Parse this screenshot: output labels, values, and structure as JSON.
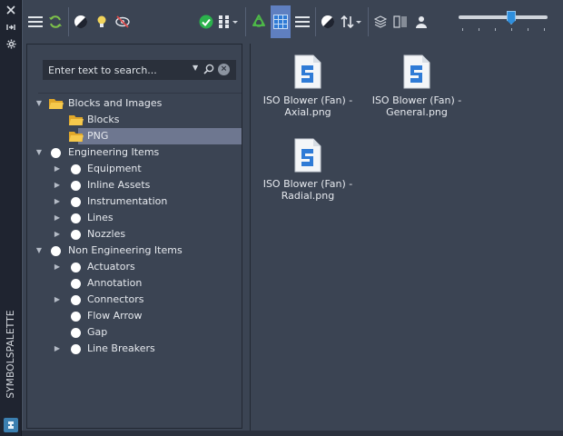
{
  "palette": {
    "title": "SYMBOLSPALETTE",
    "strip_icons": [
      "menu-icon",
      "pin-icon",
      "settings-icon",
      "app-logo-icon"
    ]
  },
  "toolbar": {
    "icons": [
      "hamburger-menu-icon",
      "refresh-icon",
      "contrast-icon",
      "lightbulb-icon",
      "visibility-toggle-icon",
      "checkmark-icon",
      "grid-options-icon",
      "recycle-icon",
      "grid-view-icon",
      "list-view-icon",
      "display-mode-icon",
      "sort-icon",
      "layers-icon",
      "text-abc-icon",
      "user-icon"
    ],
    "zoom_level": 0.6
  },
  "search": {
    "placeholder": "Enter text to search..."
  },
  "tree": [
    {
      "label": "Blocks and Images",
      "expanded": true,
      "icon": "folder-open-icon",
      "children": [
        {
          "label": "Blocks",
          "icon": "folder-open-icon"
        },
        {
          "label": "PNG",
          "icon": "folder-open-icon",
          "selected": true
        }
      ]
    },
    {
      "label": "Engineering Items",
      "expanded": true,
      "icon": "circle-icon",
      "children": [
        {
          "label": "Equipment",
          "expandable": true
        },
        {
          "label": "Inline Assets",
          "expandable": true
        },
        {
          "label": "Instrumentation",
          "expandable": true
        },
        {
          "label": "Lines",
          "expandable": true
        },
        {
          "label": "Nozzles",
          "expandable": true
        }
      ]
    },
    {
      "label": "Non Engineering Items",
      "expanded": true,
      "icon": "circle-icon",
      "children": [
        {
          "label": "Actuators",
          "expandable": true
        },
        {
          "label": "Annotation",
          "expandable": false
        },
        {
          "label": "Connectors",
          "expandable": true
        },
        {
          "label": "Flow Arrow",
          "expandable": false
        },
        {
          "label": "Gap",
          "expandable": false
        },
        {
          "label": "Line Breakers",
          "expandable": true
        }
      ]
    }
  ],
  "files": [
    {
      "line1": "ISO Blower (Fan) -",
      "line2": "Axial.png"
    },
    {
      "line1": "ISO Blower (Fan) -",
      "line2": "General.png"
    },
    {
      "line1": "ISO Blower (Fan) -",
      "line2": "Radial.png"
    }
  ],
  "colors": {
    "panel": "#3b4453",
    "strip": "#1f2430",
    "selection": "#6e7790",
    "accent_blue": "#2f8fdd",
    "check_green": "#2bb24c"
  }
}
